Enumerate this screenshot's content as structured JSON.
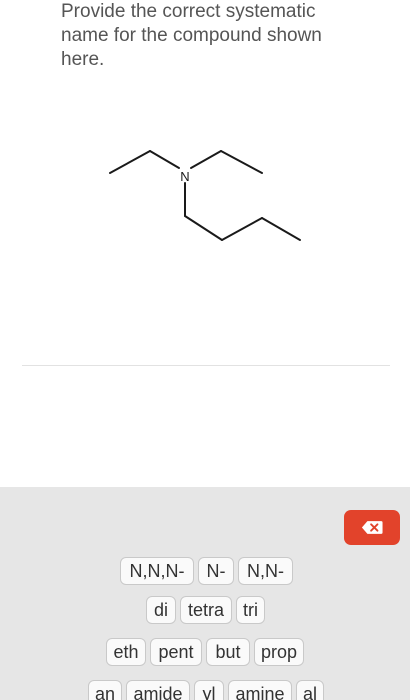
{
  "question": {
    "text": "Provide the correct systematic name for the compound shown here."
  },
  "molecule": {
    "atom_label": "N"
  },
  "answer_tray": {
    "delete_icon": "backspace-x-icon",
    "delete_color": "#e2432b",
    "rows": [
      {
        "tiles": [
          "N,N,N-",
          "N-",
          "N,N-"
        ]
      },
      {
        "tiles": [
          "di",
          "tetra",
          "tri"
        ]
      },
      {
        "tiles": [
          "eth",
          "pent",
          "but",
          "prop"
        ]
      },
      {
        "tiles": [
          "an",
          "amide",
          "yl",
          "amine",
          "al"
        ]
      }
    ]
  }
}
